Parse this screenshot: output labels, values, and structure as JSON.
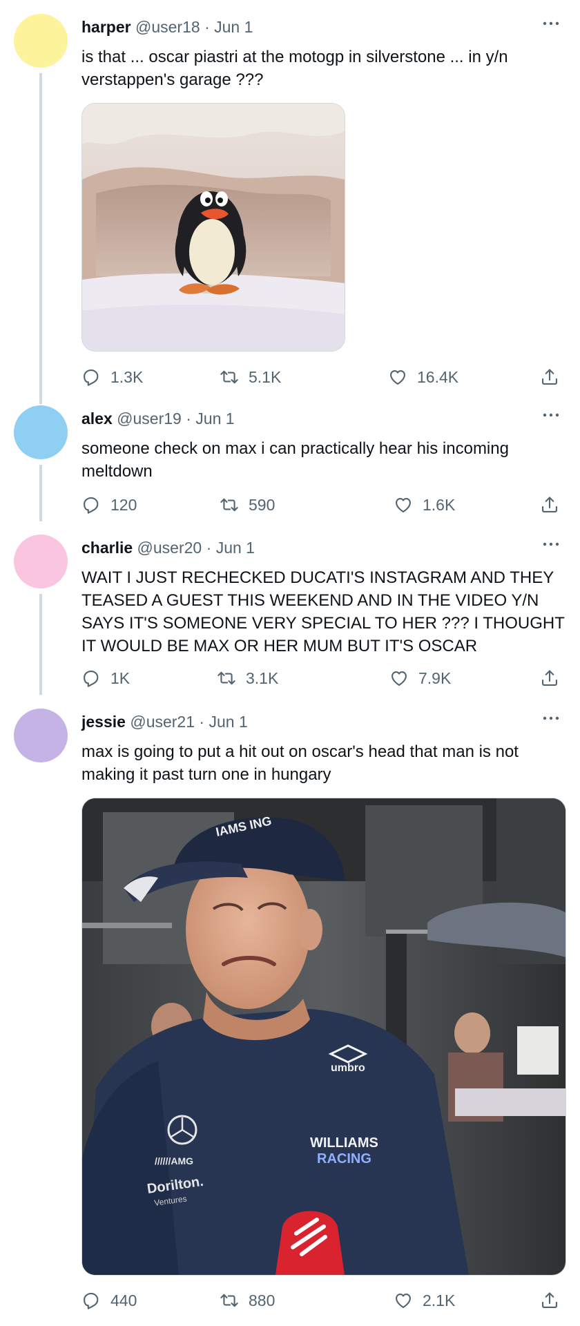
{
  "colors": {
    "avatar_harper": "#fdf39a",
    "avatar_alex": "#8fcff2",
    "avatar_charlie": "#f9c5e0",
    "avatar_jessie": "#c6b3e6",
    "text_secondary": "#536471",
    "thread_line": "#cfd9de"
  },
  "icons": {
    "reply": "speech-bubble-icon",
    "retweet": "retweet-arrows-icon",
    "like": "heart-icon",
    "share": "upload-arrow-icon",
    "more": "ellipsis-icon"
  },
  "tweets": [
    {
      "name": "harper",
      "handle": "@user18",
      "sep": "·",
      "date": "Jun 1",
      "text": "is that ... oscar piastri at the motogp in silverstone ... in y/n verstappen's garage ???",
      "media": "photo: penguin figurine standing in a small cave opening",
      "replies": "1.3K",
      "retweets": "5.1K",
      "likes": "16.4K"
    },
    {
      "name": "alex",
      "handle": "@user19",
      "sep": "·",
      "date": "Jun 1",
      "text": "someone check on max i can practically hear his incoming meltdown",
      "replies": "120",
      "retweets": "590",
      "likes": "1.6K"
    },
    {
      "name": "charlie",
      "handle": "@user20",
      "sep": "·",
      "date": "Jun 1",
      "text": "WAIT I JUST RECHECKED DUCATI'S INSTAGRAM AND THEY TEASED A GUEST THIS WEEKEND AND IN THE VIDEO Y/N SAYS IT'S SOMEONE VERY SPECIAL TO HER ??? I THOUGHT IT WOULD BE MAX OR HER MUM BUT IT'S OSCAR",
      "replies": "1K",
      "retweets": "3.1K",
      "likes": "7.9K"
    },
    {
      "name": "jessie",
      "handle": "@user21",
      "sep": "·",
      "date": "Jun 1",
      "text": "max is going to put a hit out on oscar's head that man is not making it past turn one in hungary",
      "media": "photo: tearful racing driver in team cap and shirt being interviewed",
      "media_text": {
        "cap": "IAMS\nING",
        "shirt_brand": "umbro",
        "team_line1": "WILLIAMS",
        "team_line2": "RACING",
        "sponsor1": "//////AMG",
        "sponsor2": "Dorilton.",
        "sponsor3": "Ventures"
      },
      "replies": "440",
      "retweets": "880",
      "likes": "2.1K"
    }
  ]
}
